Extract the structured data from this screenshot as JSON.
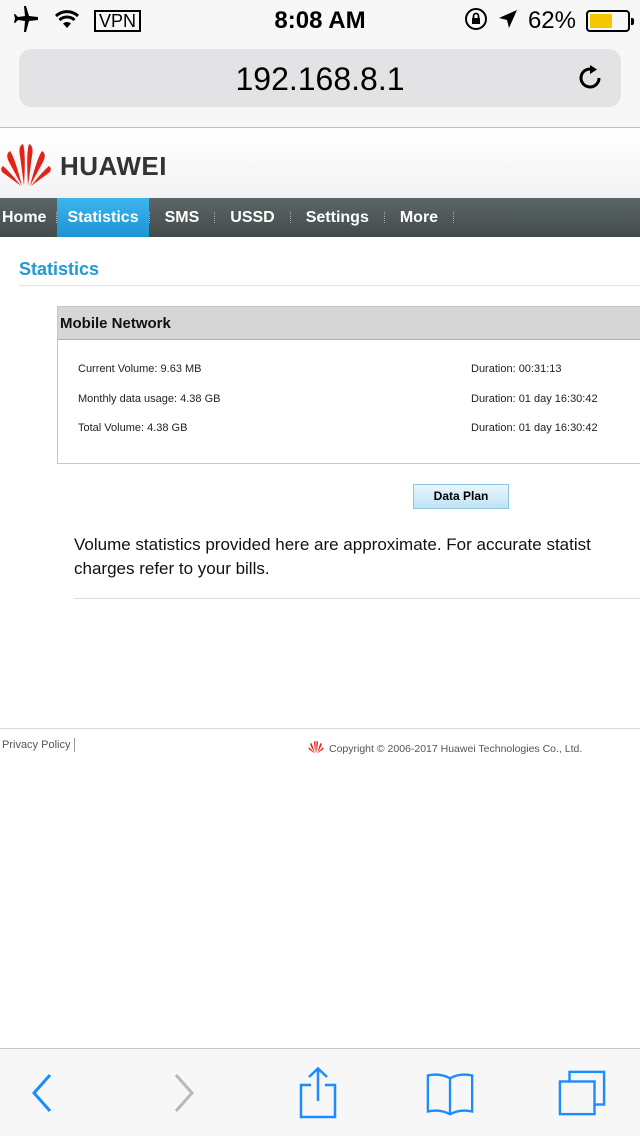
{
  "status_bar": {
    "vpn_label": "VPN",
    "time": "8:08 AM",
    "battery_percent": "62%",
    "battery_level": 0.62,
    "icons": [
      "airplane-icon",
      "wifi-icon",
      "rotation-lock-icon",
      "location-icon",
      "battery-icon"
    ]
  },
  "browser": {
    "url": "192.168.8.1",
    "reload_icon": "reload-icon"
  },
  "brand": {
    "name": "HUAWEI",
    "color": "#e2231a"
  },
  "nav": {
    "items": [
      {
        "label": "Home"
      },
      {
        "label": "Statistics",
        "active": true
      },
      {
        "label": "SMS"
      },
      {
        "label": "USSD"
      },
      {
        "label": "Settings"
      },
      {
        "label": "More"
      }
    ],
    "active_color": "#1f9ad6"
  },
  "page": {
    "title": "Statistics",
    "panel": {
      "heading": "Mobile Network",
      "rows": [
        {
          "label": "Current Volume: 9.63 MB",
          "duration": "Duration: 00:31:13"
        },
        {
          "label": "Monthly data usage: 4.38 GB",
          "duration": "Duration: 01 day 16:30:42"
        },
        {
          "label": "Total Volume: 4.38 GB",
          "duration": "Duration: 01 day 16:30:42"
        }
      ]
    },
    "data_plan_button": "Data Plan",
    "note_line1": "Volume statistics provided here are approximate. For accurate statist",
    "note_line2": "charges refer to your bills."
  },
  "footer": {
    "privacy": "Privacy Policy",
    "copyright": "Copyright © 2006-2017 Huawei Technologies Co., Ltd."
  },
  "toolbar": {
    "icons": [
      "back-icon",
      "forward-icon",
      "share-icon",
      "bookmarks-icon",
      "tabs-icon"
    ],
    "accent": "#1a8cff"
  }
}
